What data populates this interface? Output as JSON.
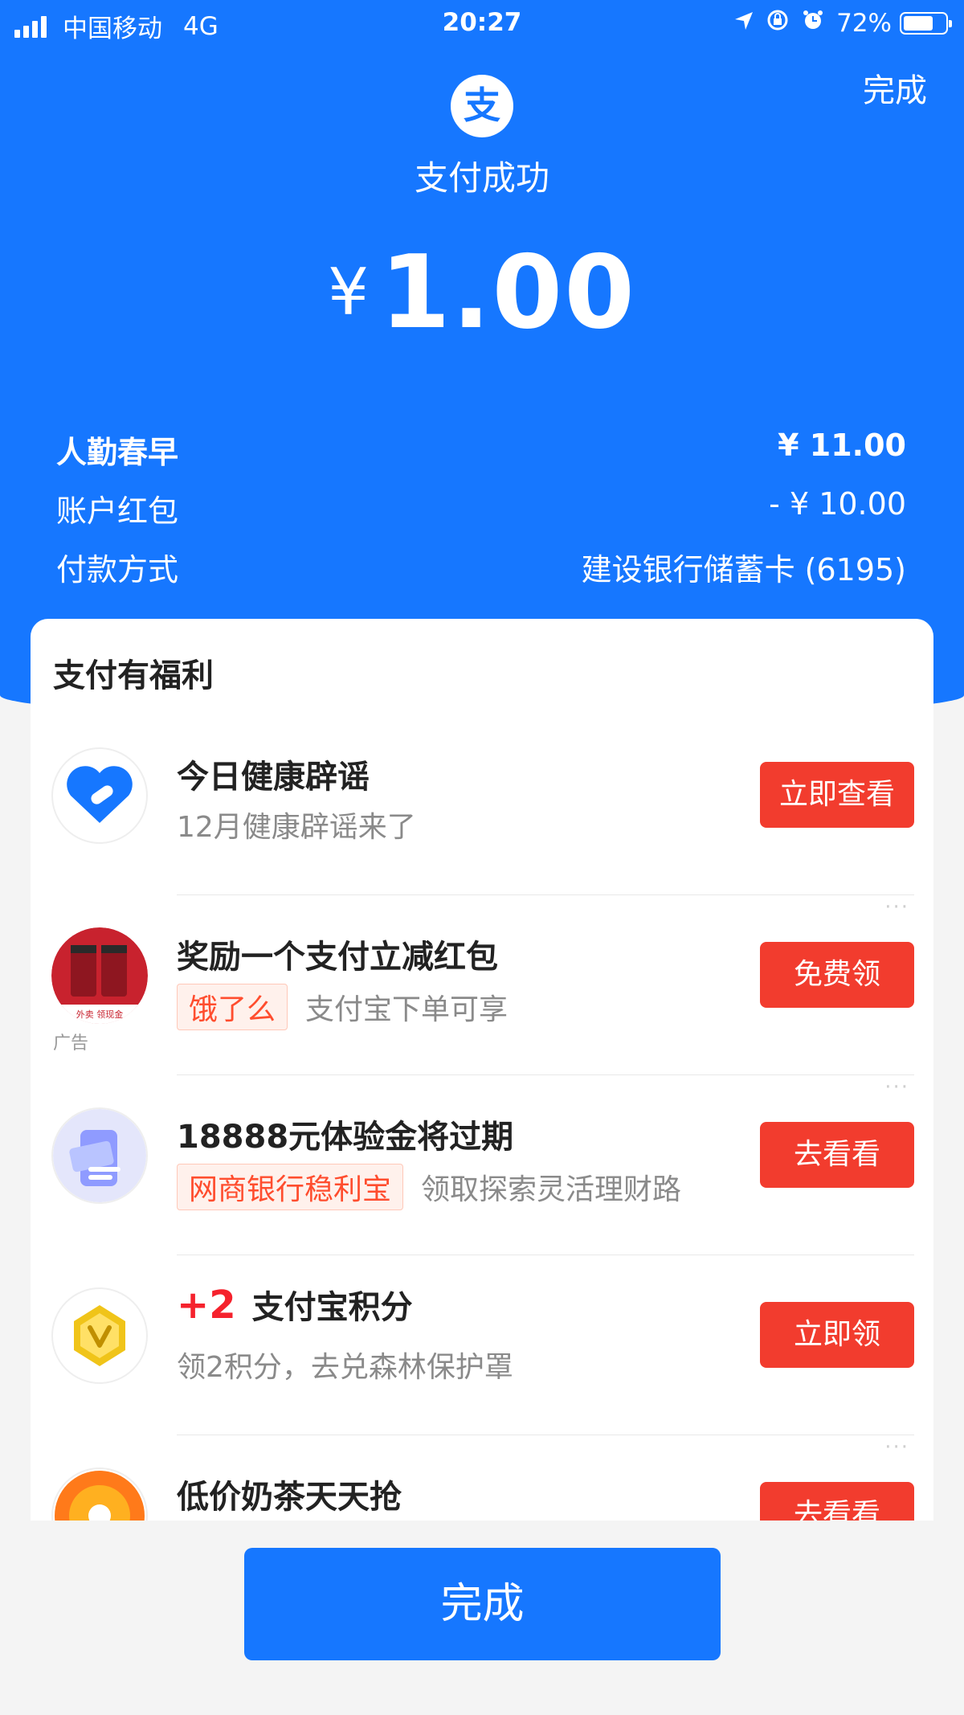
{
  "status_bar": {
    "carrier": "中国移动",
    "network": "4G",
    "time": "20:27",
    "battery_percent": "72%",
    "battery_level": 0.72
  },
  "header": {
    "done_label": "完成",
    "logo_char": "支",
    "title": "支付成功",
    "currency": "¥",
    "amount": "1.00"
  },
  "details": [
    {
      "label": "人勤春早",
      "value": "¥ 11.00"
    },
    {
      "label": "账户红包",
      "value": "- ¥ 10.00"
    },
    {
      "label": "付款方式",
      "value": "建设银行储蓄卡 (6195)"
    }
  ],
  "benefits": {
    "title": "支付有福利",
    "items": [
      {
        "title": "今日健康辟谣",
        "subtitle": "12月健康辟谣来了",
        "button": "立即查看",
        "icon": "heart-shield-icon"
      },
      {
        "title": "奖励一个支付立减红包",
        "tag": "饿了么",
        "subtitle": "支付宝下单可享",
        "button": "免费领",
        "ad_label": "广告",
        "more": "···",
        "icon": "coffee-cups-icon",
        "image_text": "外卖 领现金"
      },
      {
        "title": "18888元体验金将过期",
        "tag": "网商银行稳利宝",
        "subtitle": "领取探索灵活理财路",
        "button": "去看看",
        "more": "···",
        "icon": "phone-card-icon"
      },
      {
        "plus": "+2",
        "title": "支付宝积分",
        "subtitle": "领2积分，去兑森林保护罩",
        "button": "立即领",
        "icon": "gold-coin-icon"
      },
      {
        "title": "低价奶茶天天抢",
        "button": "去看看",
        "more": "···",
        "icon": "milk-tea-icon"
      }
    ]
  },
  "footer": {
    "done_label": "完成"
  },
  "colors": {
    "brand_blue": "#1677ff",
    "action_red": "#f23c2e",
    "plus_red": "#f5222d"
  }
}
